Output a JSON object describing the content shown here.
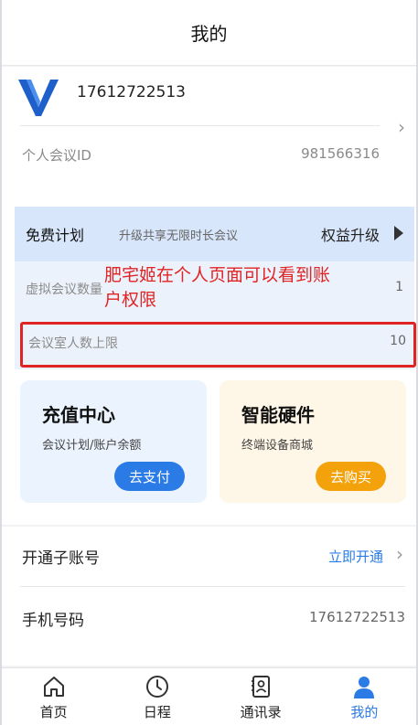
{
  "header": {
    "title": "我的"
  },
  "profile": {
    "phone": "17612722513",
    "meeting_id_label": "个人会议ID",
    "meeting_id_value": "981566316",
    "logo_icon": "v-logo-icon"
  },
  "plan": {
    "name": "免费计划",
    "description": "升级共享无限时长会议",
    "upgrade_label": "权益升级",
    "virtual_meetings_label": "虚拟会议数量",
    "virtual_meetings_value": "1",
    "room_capacity_label": "会议室人数上限",
    "room_capacity_value": "10"
  },
  "annotation": {
    "text": "肥宅姬在个人页面可以看到账户权限"
  },
  "tiles": {
    "recharge": {
      "title": "充值中心",
      "subtitle": "会议计划/账户余额",
      "button": "去支付"
    },
    "hardware": {
      "title": "智能硬件",
      "subtitle": "终端设备商城",
      "button": "去购买"
    }
  },
  "settings": {
    "sub_account_label": "开通子账号",
    "sub_account_action": "立即开通",
    "phone_label": "手机号码",
    "phone_value": "17612722513"
  },
  "tabbar": {
    "items": [
      {
        "label": "首页",
        "icon": "home-icon"
      },
      {
        "label": "日程",
        "icon": "clock-icon"
      },
      {
        "label": "通讯录",
        "icon": "contacts-icon"
      },
      {
        "label": "我的",
        "icon": "person-icon"
      }
    ]
  },
  "colors": {
    "accent": "#2a7be6",
    "warning": "#f4a20b",
    "annotation": "#e02424"
  }
}
